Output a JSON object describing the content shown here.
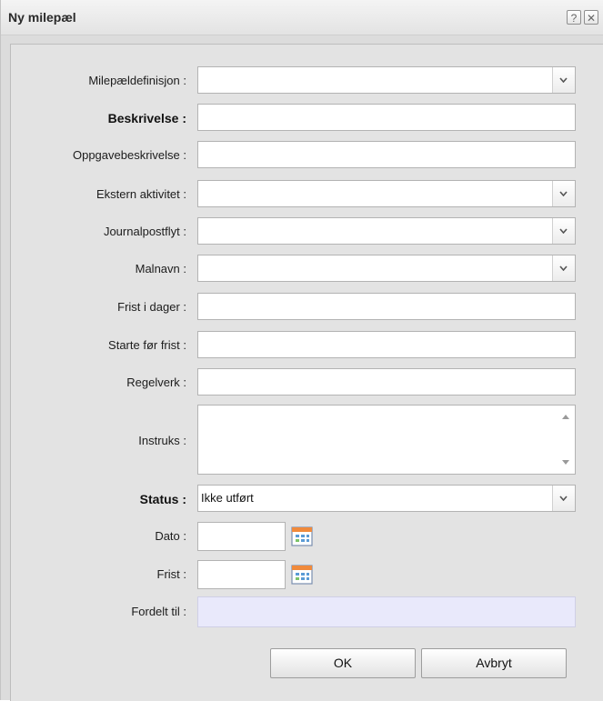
{
  "window": {
    "title": "Ny milepæl",
    "help_label": "?",
    "close_label": "✕"
  },
  "form": {
    "milepaeldefinisjon": {
      "label": "Milepældefinisjon :",
      "value": ""
    },
    "beskrivelse": {
      "label": "Beskrivelse :",
      "value": ""
    },
    "oppgavebeskrivelse": {
      "label": "Oppgavebeskrivelse :",
      "value": ""
    },
    "ekstern_aktivitet": {
      "label": "Ekstern aktivitet :",
      "value": ""
    },
    "journalpostflyt": {
      "label": "Journalpostflyt :",
      "value": ""
    },
    "malnavn": {
      "label": "Malnavn :",
      "value": ""
    },
    "frist_i_dager": {
      "label": "Frist i dager :",
      "value": ""
    },
    "starte_for_frist": {
      "label": "Starte før frist :",
      "value": ""
    },
    "regelverk": {
      "label": "Regelverk :",
      "value": ""
    },
    "instruks": {
      "label": "Instruks :",
      "value": ""
    },
    "status": {
      "label": "Status :",
      "value": "Ikke utført"
    },
    "dato": {
      "label": "Dato :",
      "value": ""
    },
    "frist": {
      "label": "Frist :",
      "value": ""
    },
    "fordelt_til": {
      "label": "Fordelt til :",
      "value": ""
    }
  },
  "buttons": {
    "ok": "OK",
    "cancel": "Avbryt"
  },
  "colors": {
    "readonly_bg": "#e9e9fb",
    "panel_bg": "#e3e3e3"
  }
}
